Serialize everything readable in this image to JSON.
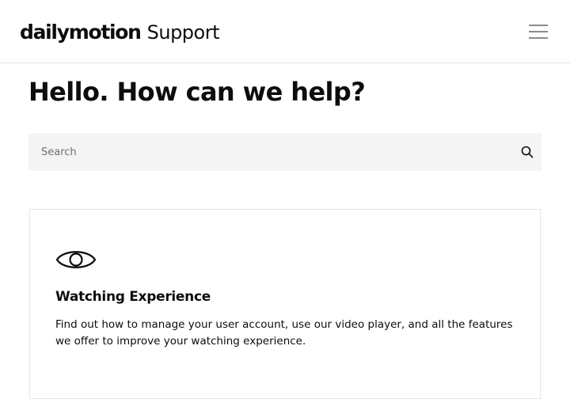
{
  "header": {
    "brand": "dailymotion",
    "brand_suffix": "Support",
    "menu_icon": "hamburger-menu-icon"
  },
  "main": {
    "title": "Hello. How can we help?",
    "search": {
      "placeholder": "Search",
      "value": "",
      "icon": "search-icon"
    },
    "categories": [
      {
        "icon": "eye-icon",
        "title": "Watching Experience",
        "description": "Find out how to manage your user account, use our video player, and all the features we offer to improve your watching experience."
      }
    ]
  },
  "colors": {
    "text": "#0d0d0d",
    "search_background": "#f4f4f4",
    "border": "#e6e6e6",
    "menu_icon": "#8c8c8c"
  }
}
